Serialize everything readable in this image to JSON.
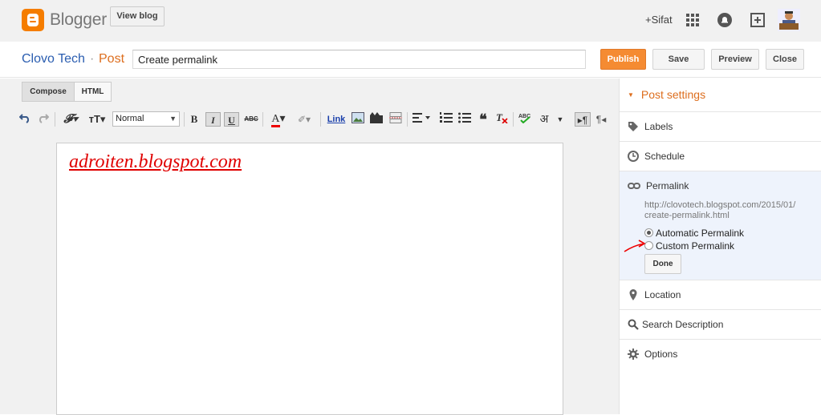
{
  "app": {
    "brand": "Blogger",
    "view_blog": "View blog",
    "user": "+Sifat"
  },
  "post": {
    "blog_name": "Clovo Tech",
    "separator": "·",
    "post_word": "Post",
    "title_value": "Create permalink",
    "publish": "Publish",
    "save": "Save",
    "preview": "Preview",
    "close": "Close"
  },
  "editor": {
    "tabs": {
      "compose": "Compose",
      "html": "HTML"
    },
    "font_size": "Normal",
    "link_label": "Link",
    "hindi_glyph": "अ",
    "body_text": "adroiten.blogspot.com"
  },
  "sidebar": {
    "title": "Post settings",
    "labels": "Labels",
    "schedule": "Schedule",
    "permalink": "Permalink",
    "permalink_url_line1": "http://clovotech.blogspot.com/2015/01/",
    "permalink_url_line2": "create-permalink.html",
    "automatic": "Automatic Permalink",
    "custom": "Custom Permalink",
    "done": "Done",
    "location": "Location",
    "search_description": "Search Description",
    "options": "Options"
  },
  "colors": {
    "brand_orange": "#f57d00",
    "publish_orange": "#f58b32",
    "blog_blue": "#2a5db0",
    "body_text_red": "#e00000",
    "permalink_bg": "#eef3fc"
  }
}
